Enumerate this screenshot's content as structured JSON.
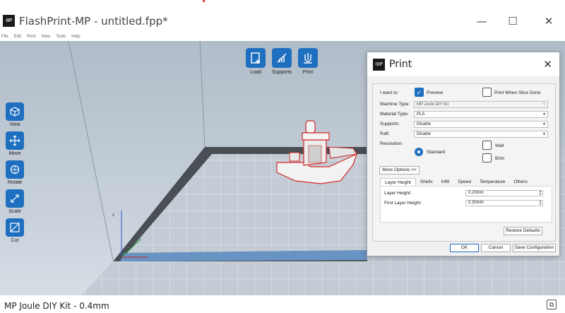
{
  "window": {
    "title": "FlashPrint-MP - untitled.fpp*",
    "logo_text": "IIIP",
    "minimize_glyph": "—",
    "maximize_glyph": "☐",
    "close_glyph": "✕"
  },
  "menu": [
    "File",
    "Edit",
    "Print",
    "View",
    "Tools",
    "Help"
  ],
  "top_toolbar": {
    "load": "Load",
    "supports": "Supports",
    "print": "Print"
  },
  "left_toolbar": {
    "view": "View",
    "move": "Move",
    "rotate": "Rotate",
    "scale": "Scale",
    "cut": "Cut"
  },
  "status": {
    "text": "MP Joule DIY Kit - 0.4mm"
  },
  "dialog": {
    "logo_text": "IIIP",
    "title": "Print",
    "close_glyph": "✕",
    "i_want_to": "I want to:",
    "preview": "Preview",
    "print_when_slice_done": "Print When Slice Done",
    "machine_type_label": "Machine Type:",
    "machine_type_value": "MP Joule DIY Kit",
    "material_type_label": "Material Type:",
    "material_type_value": "PLA",
    "supports_label": "Supports:",
    "supports_value": "Disable",
    "raft_label": "Raft:",
    "raft_value": "Disable",
    "resolution_label": "Resolution:",
    "resolution_standard": "Standard",
    "resolution_wall": "Wall",
    "resolution_brim": "Brim",
    "more_options": "More Options >>",
    "tabs": [
      "Layer Height",
      "Shells",
      "Infill",
      "Speed",
      "Temperature",
      "Others"
    ],
    "layer_height_label": "Layer Height:",
    "layer_height_value": "0.20mm",
    "first_layer_height_label": "First Layer Height:",
    "first_layer_height_value": "0.30mm",
    "restore_defaults": "Restore Defaults",
    "ok": "OK",
    "cancel": "Cancel",
    "save_configuration": "Save Configuration"
  },
  "colors": {
    "accent": "#1f6fc0",
    "model_outline": "#d62828"
  }
}
